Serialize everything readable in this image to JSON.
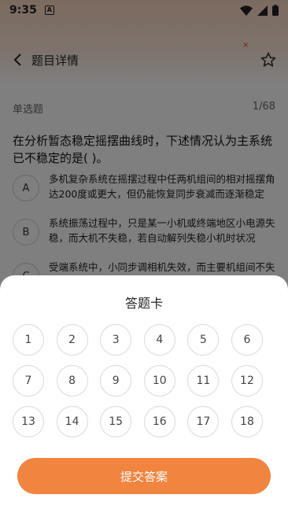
{
  "status": {
    "time": "9:35",
    "notification_badge": "A"
  },
  "nav": {
    "back_icon": "chevron-left-icon",
    "title": "题目详情",
    "star_icon": "star-outline-icon"
  },
  "question": {
    "type": "单选题",
    "progress": "1/68",
    "text": "在分析暂态稳定摇摆曲线时，下述情况认为主系统已不稳定的是(    )。",
    "options": [
      {
        "key": "A",
        "text": "多机复杂系统在摇摆过程中任两机组间的相对摇摆角达200度或更大，但仍能恢复同步衰减而逐渐稳定"
      },
      {
        "key": "B",
        "text": "系统振荡过程中，只是某一小机或终端地区小电源失稳，而大机不失稳，若自动解列失稳小机时状况"
      },
      {
        "key": "C",
        "text": "受端系统中，小同步调相机失效，而主要机组间不失"
      }
    ]
  },
  "answer_sheet": {
    "title": "答题卡",
    "numbers": [
      "1",
      "2",
      "3",
      "4",
      "5",
      "6",
      "7",
      "8",
      "9",
      "10",
      "11",
      "12",
      "13",
      "14",
      "15",
      "16",
      "17",
      "18"
    ],
    "submit_label": "提交答案"
  },
  "colors": {
    "accent": "#f1843f",
    "header_tint": "#f7d5bf"
  }
}
